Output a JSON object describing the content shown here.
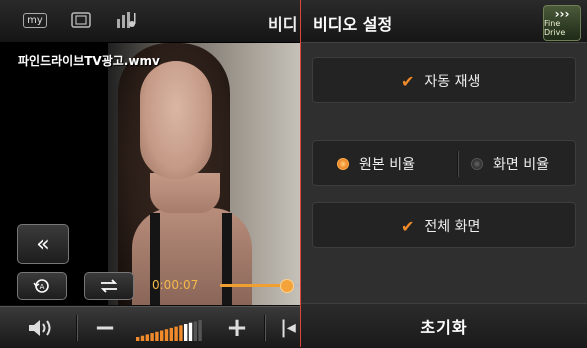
{
  "player": {
    "topbar": {
      "my_label": "my",
      "title_partial": "비디"
    },
    "watermark": "파인드라이브TV광고.wmv",
    "time": "0:00:07",
    "progress_fraction": 0.82,
    "volume_level_fraction": 0.85
  },
  "panel": {
    "title": "비디오 설정",
    "logo_text": "Fine Drive",
    "options": {
      "autoplay": {
        "label": "자동 재생",
        "checked": true
      },
      "aspect": {
        "original_label": "원본 비율",
        "original_selected": true,
        "screen_label": "화면 비율",
        "screen_selected": false
      },
      "fullscreen": {
        "label": "전체 화면",
        "checked": true
      }
    },
    "reset_label": "초기화"
  },
  "colors": {
    "accent": "#f08a2a",
    "divider": "#e0443a",
    "time_text": "#f5b84a"
  },
  "icons": [
    "my-icon",
    "window-icon",
    "music-icon",
    "back-icon",
    "repeat-icon",
    "swap-icon",
    "volume-icon",
    "minus-icon",
    "plus-icon",
    "skip-icon",
    "check-icon",
    "radio-icon"
  ]
}
